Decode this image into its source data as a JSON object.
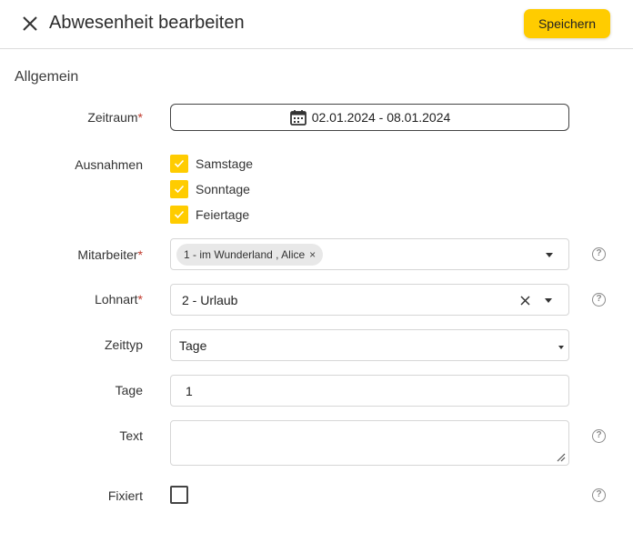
{
  "header": {
    "title": "Abwesenheit bearbeiten",
    "save_label": "Speichern"
  },
  "section": {
    "title": "Allgemein"
  },
  "fields": {
    "zeitraum": {
      "label": "Zeitraum",
      "required": "*",
      "value": "02.01.2024 - 08.01.2024"
    },
    "ausnahmen": {
      "label": "Ausnahmen",
      "options": [
        {
          "label": "Samstage",
          "checked": true
        },
        {
          "label": "Sonntage",
          "checked": true
        },
        {
          "label": "Feiertage",
          "checked": true
        }
      ]
    },
    "mitarbeiter": {
      "label": "Mitarbeiter",
      "required": "*",
      "chip": "1 - im Wunderland , Alice",
      "chip_remove": "×"
    },
    "lohnart": {
      "label": "Lohnart",
      "required": "*",
      "value": "2 - Urlaub"
    },
    "zeittyp": {
      "label": "Zeittyp",
      "value": "Tage"
    },
    "tage": {
      "label": "Tage",
      "value": "1"
    },
    "text": {
      "label": "Text",
      "value": ""
    },
    "fixiert": {
      "label": "Fixiert",
      "checked": false
    }
  },
  "help_glyph": "?",
  "colors": {
    "accent": "#ffcc00",
    "required": "#c0392b",
    "border": "#d6d6d6"
  },
  "icons": [
    "close-icon",
    "calendar-icon",
    "check-icon",
    "chevron-down-icon",
    "clear-icon",
    "help-icon",
    "resize-handle-icon"
  ]
}
